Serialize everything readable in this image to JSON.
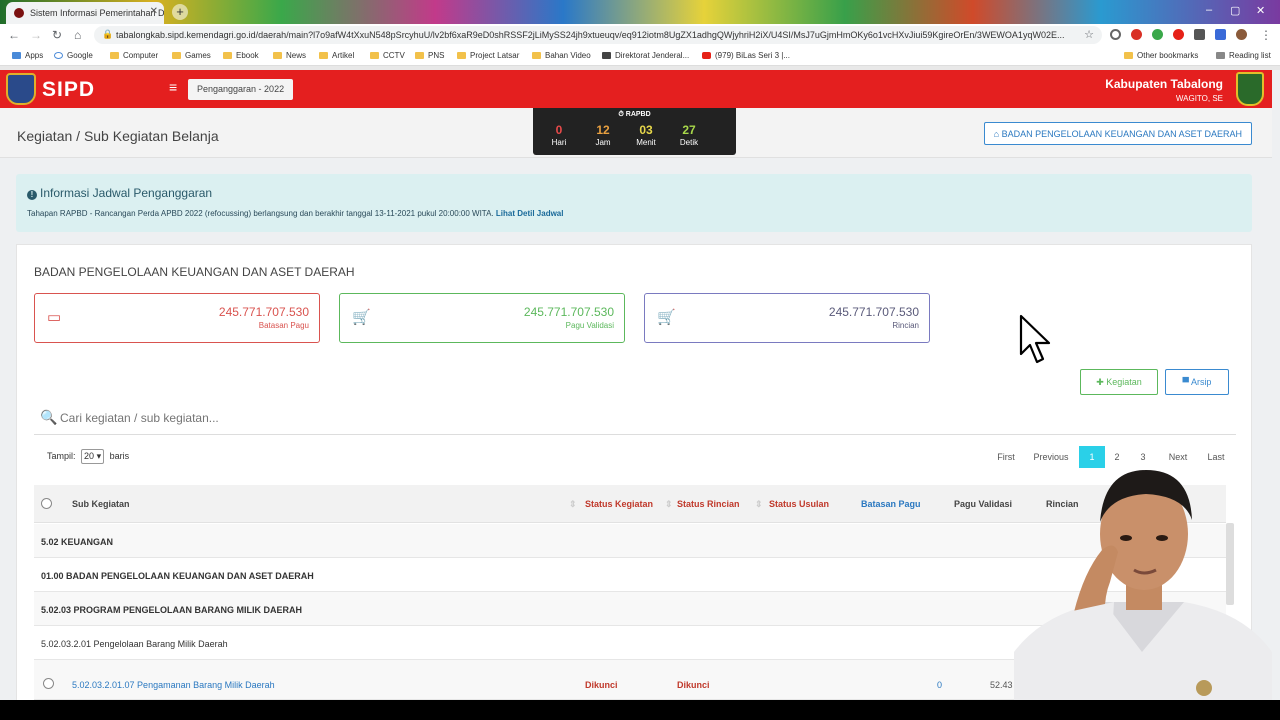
{
  "browser": {
    "tab_title": "Sistem Informasi Pemerintahan D",
    "url": "tabalongkab.sipd.kemendagri.go.id/daerah/main?l7o9afW4tXxuN548pSrcyhuU/lv2bf6xaR9eD0shRSSF2jLiMySS24jh9xtueuqv/eq912iotm8UgZX1adhgQWjyhriH2iX/U4SI/MsJ7uGjmHmOKy6o1vcHXvJiui59KgireOrEn/3WEWOA1yqW02E...",
    "bookmarks": [
      "Apps",
      "Google",
      "Computer",
      "Games",
      "Ebook",
      "News",
      "Artikel",
      "CCTV",
      "PNS",
      "Project Latsar",
      "Bahan Video",
      "Direktorat Jenderal...",
      "(979) BiLas Seri 3 |...",
      "Other bookmarks",
      "Reading list"
    ]
  },
  "header": {
    "brand": "SIPD",
    "period": "Penganggaran - 2022",
    "region": "Kabupaten Tabalong",
    "user": "WAGITO, SE"
  },
  "subheader": {
    "title": "Kegiatan / Sub Kegiatan Belanja",
    "timer_label": "RAPBD",
    "timer": [
      {
        "value": "0",
        "unit": "Hari",
        "color": "#e84a4a"
      },
      {
        "value": "12",
        "unit": "Jam",
        "color": "#e8a040"
      },
      {
        "value": "03",
        "unit": "Menit",
        "color": "#e8d84a"
      },
      {
        "value": "27",
        "unit": "Detik",
        "color": "#a8d84a"
      }
    ],
    "dept_button": "BADAN PENGELOLAAN KEUANGAN DAN ASET DAERAH"
  },
  "info": {
    "heading": "Informasi Jadwal Penganggaran",
    "text": "Tahapan RAPBD - Rancangan Perda APBD 2022 (refocussing) berlangsung dan berakhir tanggal 13-11-2021 pukul 20:00:00 WITA.",
    "link": "Lihat Detil Jadwal"
  },
  "main": {
    "title": "BADAN PENGELOLAAN KEUANGAN DAN ASET DAERAH",
    "stats": [
      {
        "value": "245.771.707.530",
        "label": "Batasan Pagu",
        "color": "#d9534f",
        "icon": "wallet-icon"
      },
      {
        "value": "245.771.707.530",
        "label": "Pagu Validasi",
        "color": "#5cb85c",
        "icon": "cart-check-icon"
      },
      {
        "value": "245.771.707.530",
        "label": "Rincian",
        "color": "#5a5ab0",
        "icon": "cart-icon"
      }
    ],
    "add_button": "Kegiatan",
    "archive_button": "Arsip",
    "search_placeholder": "Cari kegiatan / sub kegiatan...",
    "show_label": "Tampil:",
    "show_value": "20",
    "show_suffix": "baris",
    "pagination": [
      "First",
      "Previous",
      "1",
      "2",
      "3",
      "Next",
      "Last"
    ],
    "columns": [
      "Sub Kegiatan",
      "Status Kegiatan",
      "Status Rincian",
      "Status Usulan",
      "Batasan Pagu",
      "Pagu Validasi",
      "Rincian"
    ],
    "rows": [
      {
        "text": "5.02 KEUANGAN"
      },
      {
        "text": "01.00 BADAN PENGELOLAAN KEUANGAN DAN ASET DAERAH"
      },
      {
        "text": "5.02.03 PROGRAM PENGELOLAAN BARANG MILIK DAERAH"
      },
      {
        "text": "5.02.03.2.01 Pengelolaan Barang Milik Daerah"
      }
    ],
    "sub_row": {
      "name": "5.02.03.2.01.07 Pengamanan Barang Milik Daerah",
      "status_kegiatan": "Dikunci",
      "status_rincian": "Dikunci",
      "batasan_pagu": "0",
      "pagu_validasi": "52.43"
    }
  }
}
